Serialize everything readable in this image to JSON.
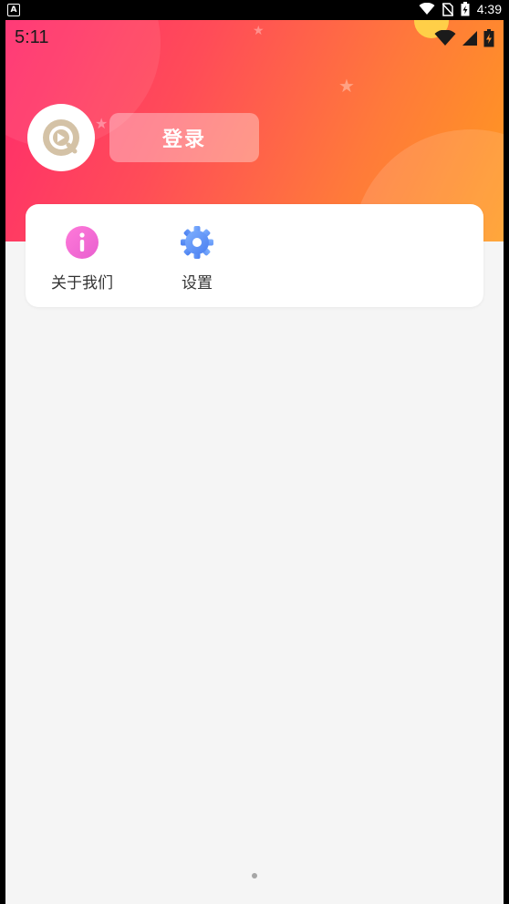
{
  "system_bar": {
    "notification_badge": "A",
    "time": "4:39",
    "icons": [
      "wifi-icon",
      "no-sim-icon",
      "battery-charging-icon"
    ]
  },
  "app_status": {
    "time": "5:11",
    "icons": [
      "wifi-icon",
      "signal-icon",
      "battery-icon"
    ]
  },
  "profile": {
    "avatar_icon": "app-logo-icon",
    "login_label": "登录"
  },
  "menu": {
    "items": [
      {
        "label": "关于我们",
        "icon": "info-icon",
        "color": "#f06bd8"
      },
      {
        "label": "设置",
        "icon": "gear-icon",
        "color": "#5b8ef5"
      }
    ]
  },
  "colors": {
    "gradient_start": "#ff2a6d",
    "gradient_end": "#ff9a1f",
    "background": "#f5f5f5"
  }
}
